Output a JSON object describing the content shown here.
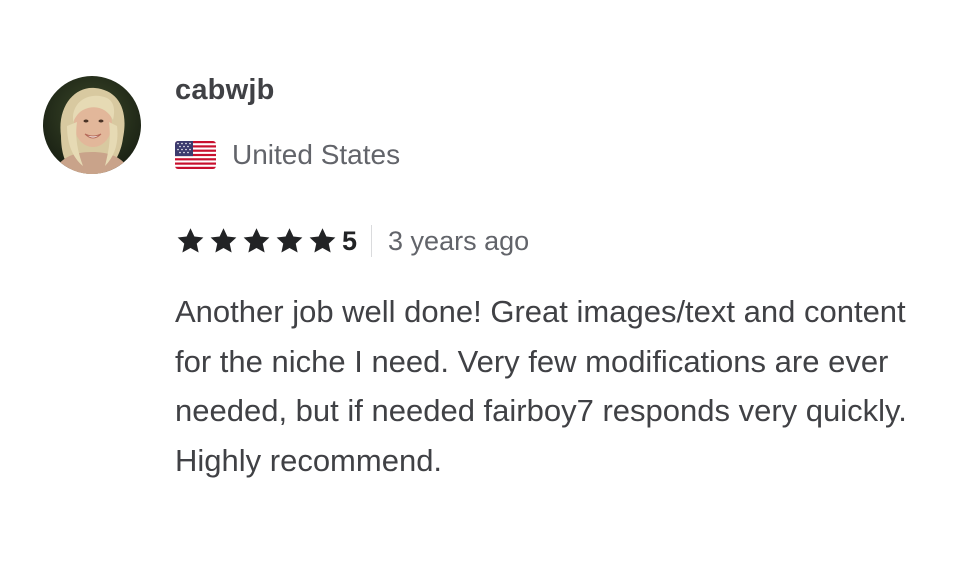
{
  "review": {
    "username": "cabwjb",
    "country": "United States",
    "country_flag_icon": "us-flag-icon",
    "rating": {
      "value": "5",
      "stars_filled": 5,
      "stars_total": 5,
      "star_color": "#222325"
    },
    "time_ago": "3 years ago",
    "text": "Another job well done! Great images/text and content for the niche I need. Very few modifications are ever needed, but if needed fairboy7 responds very quickly. Highly recommend."
  },
  "colors": {
    "text_primary": "#404145",
    "text_secondary": "#62646a",
    "divider": "#dadbdd",
    "background": "#ffffff"
  }
}
